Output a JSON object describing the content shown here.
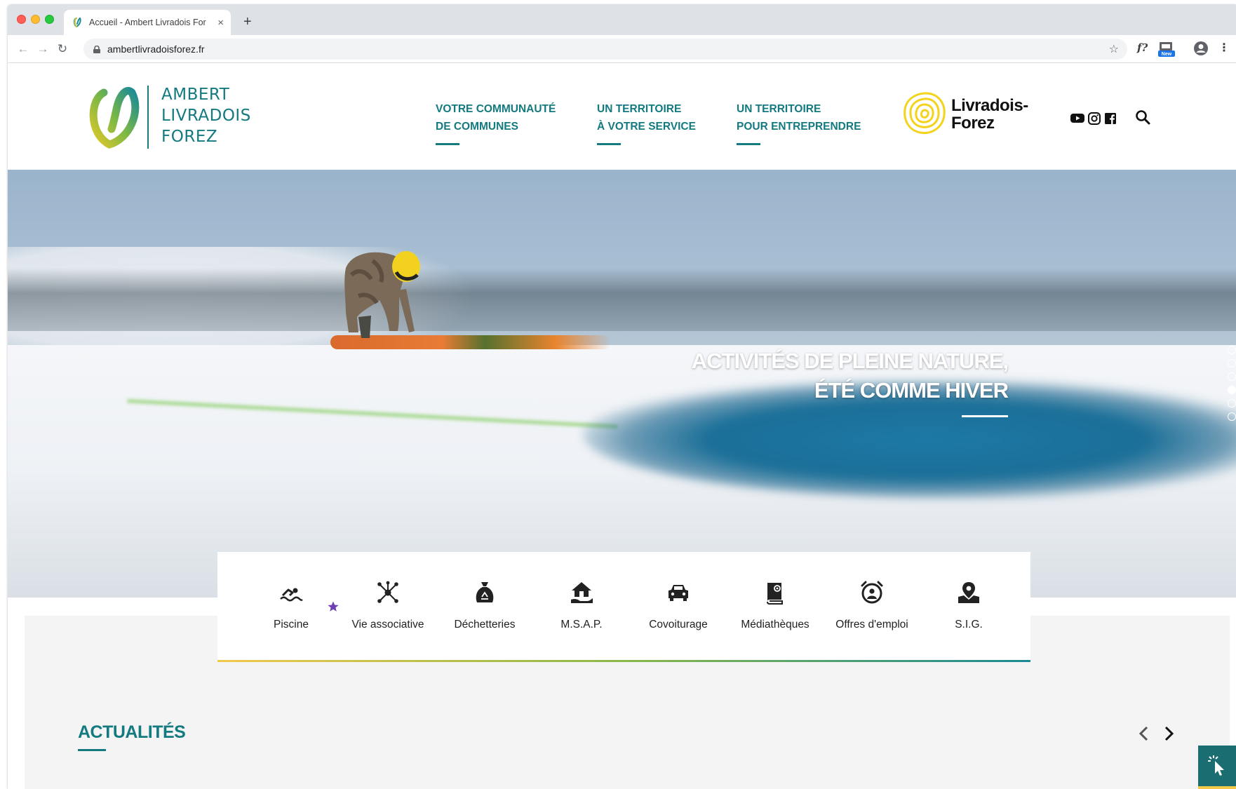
{
  "browser": {
    "tab_title": "Accueil - Ambert Livradois For",
    "tab_close": "×",
    "new_tab": "+",
    "url": "ambertlivradoisforez.fr",
    "back": "←",
    "forward": "→",
    "reload": "↻",
    "star": "☆",
    "ext_fq": "f?",
    "menu": "⋮"
  },
  "site": {
    "logo_lines": [
      "AMBERT",
      "LIVRADOIS",
      "FOREZ"
    ],
    "nav": [
      {
        "line1": "VOTRE COMMUNAUTÉ",
        "line2": "DE COMMUNES"
      },
      {
        "line1": "UN TERRITOIRE",
        "line2": "À VOTRE SERVICE"
      },
      {
        "line1": "UN TERRITOIRE",
        "line2": "POUR ENTREPRENDRE"
      }
    ],
    "partner_lines": [
      "Livradois-",
      "Forez"
    ],
    "hero": {
      "line1": "ACTIVITÉS DE PLEINE NATURE,",
      "line2": "ÉTÉ COMME HIVER",
      "slide_count": 6,
      "active_slide": 4
    },
    "quick_access": [
      {
        "label": "Piscine",
        "icon": "swimmer-icon"
      },
      {
        "label": "Vie associative",
        "icon": "network-icon"
      },
      {
        "label": "Déchetteries",
        "icon": "recycle-bag-icon"
      },
      {
        "label": "M.S.A.P.",
        "icon": "house-hand-icon"
      },
      {
        "label": "Covoiturage",
        "icon": "car-icon"
      },
      {
        "label": "Médiathèques",
        "icon": "book-icon"
      },
      {
        "label": "Offres d'emploi",
        "icon": "job-clock-icon"
      },
      {
        "label": "S.I.G.",
        "icon": "map-pin-icon"
      }
    ],
    "news_title": "ACTUALITÉS"
  },
  "colors": {
    "brand_teal": "#137a80",
    "accent_yellow": "#f2c84b",
    "accent_green": "#8ab84a",
    "star_purple": "#6f3fb3"
  }
}
